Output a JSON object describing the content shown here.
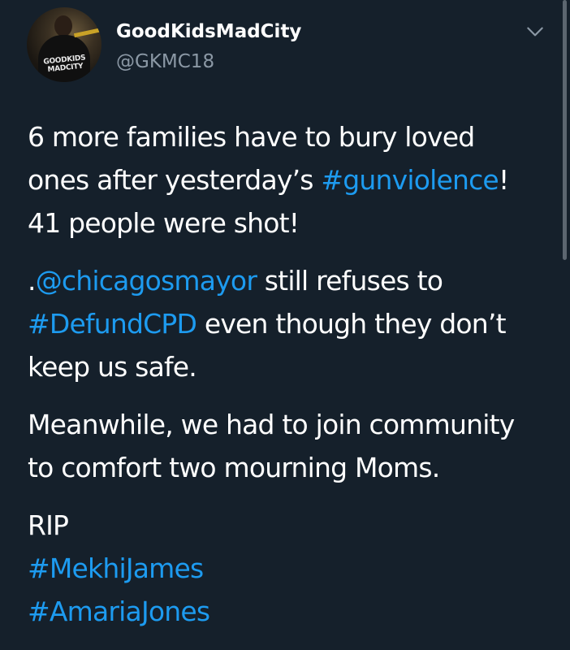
{
  "user": {
    "display_name": "GoodKidsMadCity",
    "handle": "@GKMC18",
    "avatar_shirt_text_1": "GOODKIDS",
    "avatar_shirt_text_2": "MADCITY"
  },
  "menu": {
    "icon": "chevron-down-icon"
  },
  "tweet": {
    "p1_l1": "6 more families have to bury loved",
    "p1_l2_a": "ones after yesterday’s ",
    "p1_l2_tag": "#gunviolence",
    "p1_l2_b": "!",
    "p1_l3": "41 people were shot!",
    "p2_l1_a": ".",
    "p2_l1_mention": "@chicagosmayor",
    "p2_l1_b": " still refuses to",
    "p2_l2_tag": "#DefundCPD",
    "p2_l2_b": " even though they don’t",
    "p2_l3": "keep us safe.",
    "p3_l1": "Meanwhile, we had to join community",
    "p3_l2": "to comfort two mourning Moms.",
    "p4_l1": "RIP",
    "p4_l2_tag": "#MekhiJames",
    "p4_l3_tag": "#AmariaJones"
  },
  "colors": {
    "background": "#15202b",
    "link": "#1d9bf0",
    "secondary_text": "#8b98a5"
  }
}
